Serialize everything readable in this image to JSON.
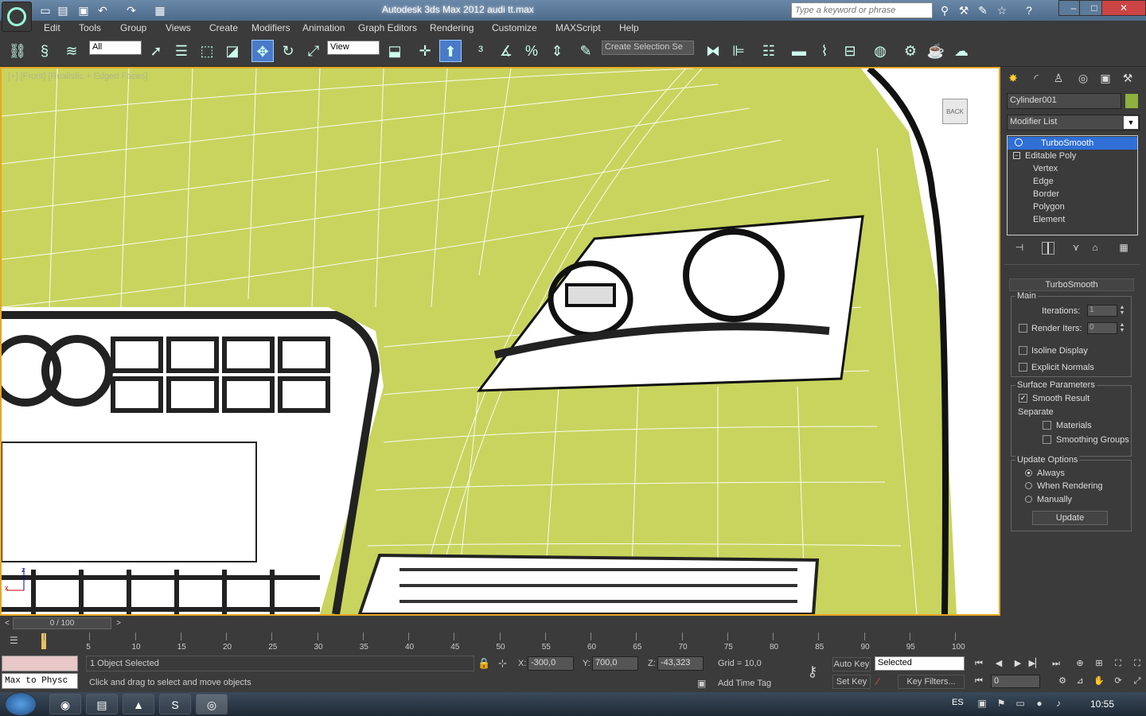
{
  "title": "Autodesk 3ds Max 2012   audi tt.max",
  "search": {
    "placeholder": "Type a keyword or phrase"
  },
  "window_controls": {
    "minimize": "–",
    "maximize": "□",
    "close": "✕"
  },
  "menu": [
    "Edit",
    "Tools",
    "Group",
    "Views",
    "Create",
    "Modifiers",
    "Animation",
    "Graph Editors",
    "Rendering",
    "Customize",
    "MAXScript",
    "Help"
  ],
  "toolbar": {
    "selection_filter": "All",
    "ref_coord": "View",
    "named_selection": "Create Selection Se"
  },
  "viewport": {
    "label": "[+] [Front] [Realistic + Edged Faces]",
    "viewcube_label": "BACK",
    "mesh_color": "#c8d45e",
    "border_color": "#e6a623"
  },
  "command_panel": {
    "object_name": "Cylinder001",
    "object_color": "#8db03e",
    "modifier_list": "Modifier List",
    "stack": [
      {
        "label": "TurboSmooth",
        "selected": true
      },
      {
        "label": "Editable Poly",
        "selected": false
      },
      {
        "label": "Vertex",
        "selected": false
      },
      {
        "label": "Edge",
        "selected": false
      },
      {
        "label": "Border",
        "selected": false
      },
      {
        "label": "Polygon",
        "selected": false
      },
      {
        "label": "Element",
        "selected": false
      }
    ],
    "rollout": {
      "title": "TurboSmooth",
      "main": "Main",
      "iterations_label": "Iterations:",
      "iterations": "1",
      "render_iters_label": "Render Iters:",
      "render_iters": "0",
      "render_iters_checked": false,
      "isoline_display": "Isoline Display",
      "explicit_normals": "Explicit Normals",
      "surface_parameters": "Surface Parameters",
      "smooth_result": "Smooth Result",
      "smooth_result_checked": true,
      "separate": "Separate",
      "materials": "Materials",
      "smoothing_groups": "Smoothing Groups",
      "update_options": "Update Options",
      "always": "Always",
      "when_rendering": "When Rendering",
      "manually": "Manually",
      "update_mode": "Always",
      "update_button": "Update"
    }
  },
  "timeline": {
    "slider": "0 / 100",
    "ticks": [
      "0",
      "5",
      "10",
      "15",
      "20",
      "25",
      "30",
      "35",
      "40",
      "45",
      "50",
      "55",
      "60",
      "65",
      "70",
      "75",
      "80",
      "85",
      "90",
      "95",
      "100"
    ]
  },
  "status": {
    "maxscript_listener": "Max to Physc",
    "selection": "1 Object Selected",
    "prompt": "Click and drag to select and move objects",
    "x_label": "X:",
    "x": "-300,0",
    "y_label": "Y:",
    "y": "700,0",
    "z_label": "Z:",
    "z": "-43,323",
    "grid": "Grid = 10,0",
    "add_time_tag": "Add Time Tag",
    "auto_key": "Auto Key",
    "set_key": "Set Key",
    "key_mode": "Selected",
    "key_filters": "Key Filters...",
    "current_frame": "0"
  },
  "taskbar": {
    "lang": "ES",
    "clock": "10:55"
  }
}
